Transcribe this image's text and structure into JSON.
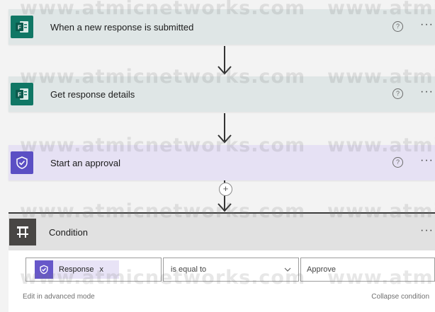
{
  "watermark": "www.atmicnetworks.com",
  "watermark_right": "www.atmic",
  "steps": [
    {
      "title": "When a new response is submitted",
      "icon": "forms-icon",
      "help": "?",
      "more": "···"
    },
    {
      "title": "Get response details",
      "icon": "forms-icon",
      "help": "?",
      "more": "···"
    },
    {
      "title": "Start an approval",
      "icon": "approvals-icon",
      "help": "?",
      "more": "···"
    }
  ],
  "add_step": "+",
  "condition": {
    "title": "Condition",
    "more": "···",
    "left_operand": {
      "token_label": "Response",
      "token_close": "x"
    },
    "operator": {
      "value": "is equal to"
    },
    "right_operand": {
      "value": "Approve"
    },
    "edit_advanced": "Edit in advanced mode",
    "collapse": "Collapse condition"
  },
  "colors": {
    "forms_green": "#107765",
    "approvals_purple": "#5b4fc4",
    "condition_dark": "#484644"
  }
}
